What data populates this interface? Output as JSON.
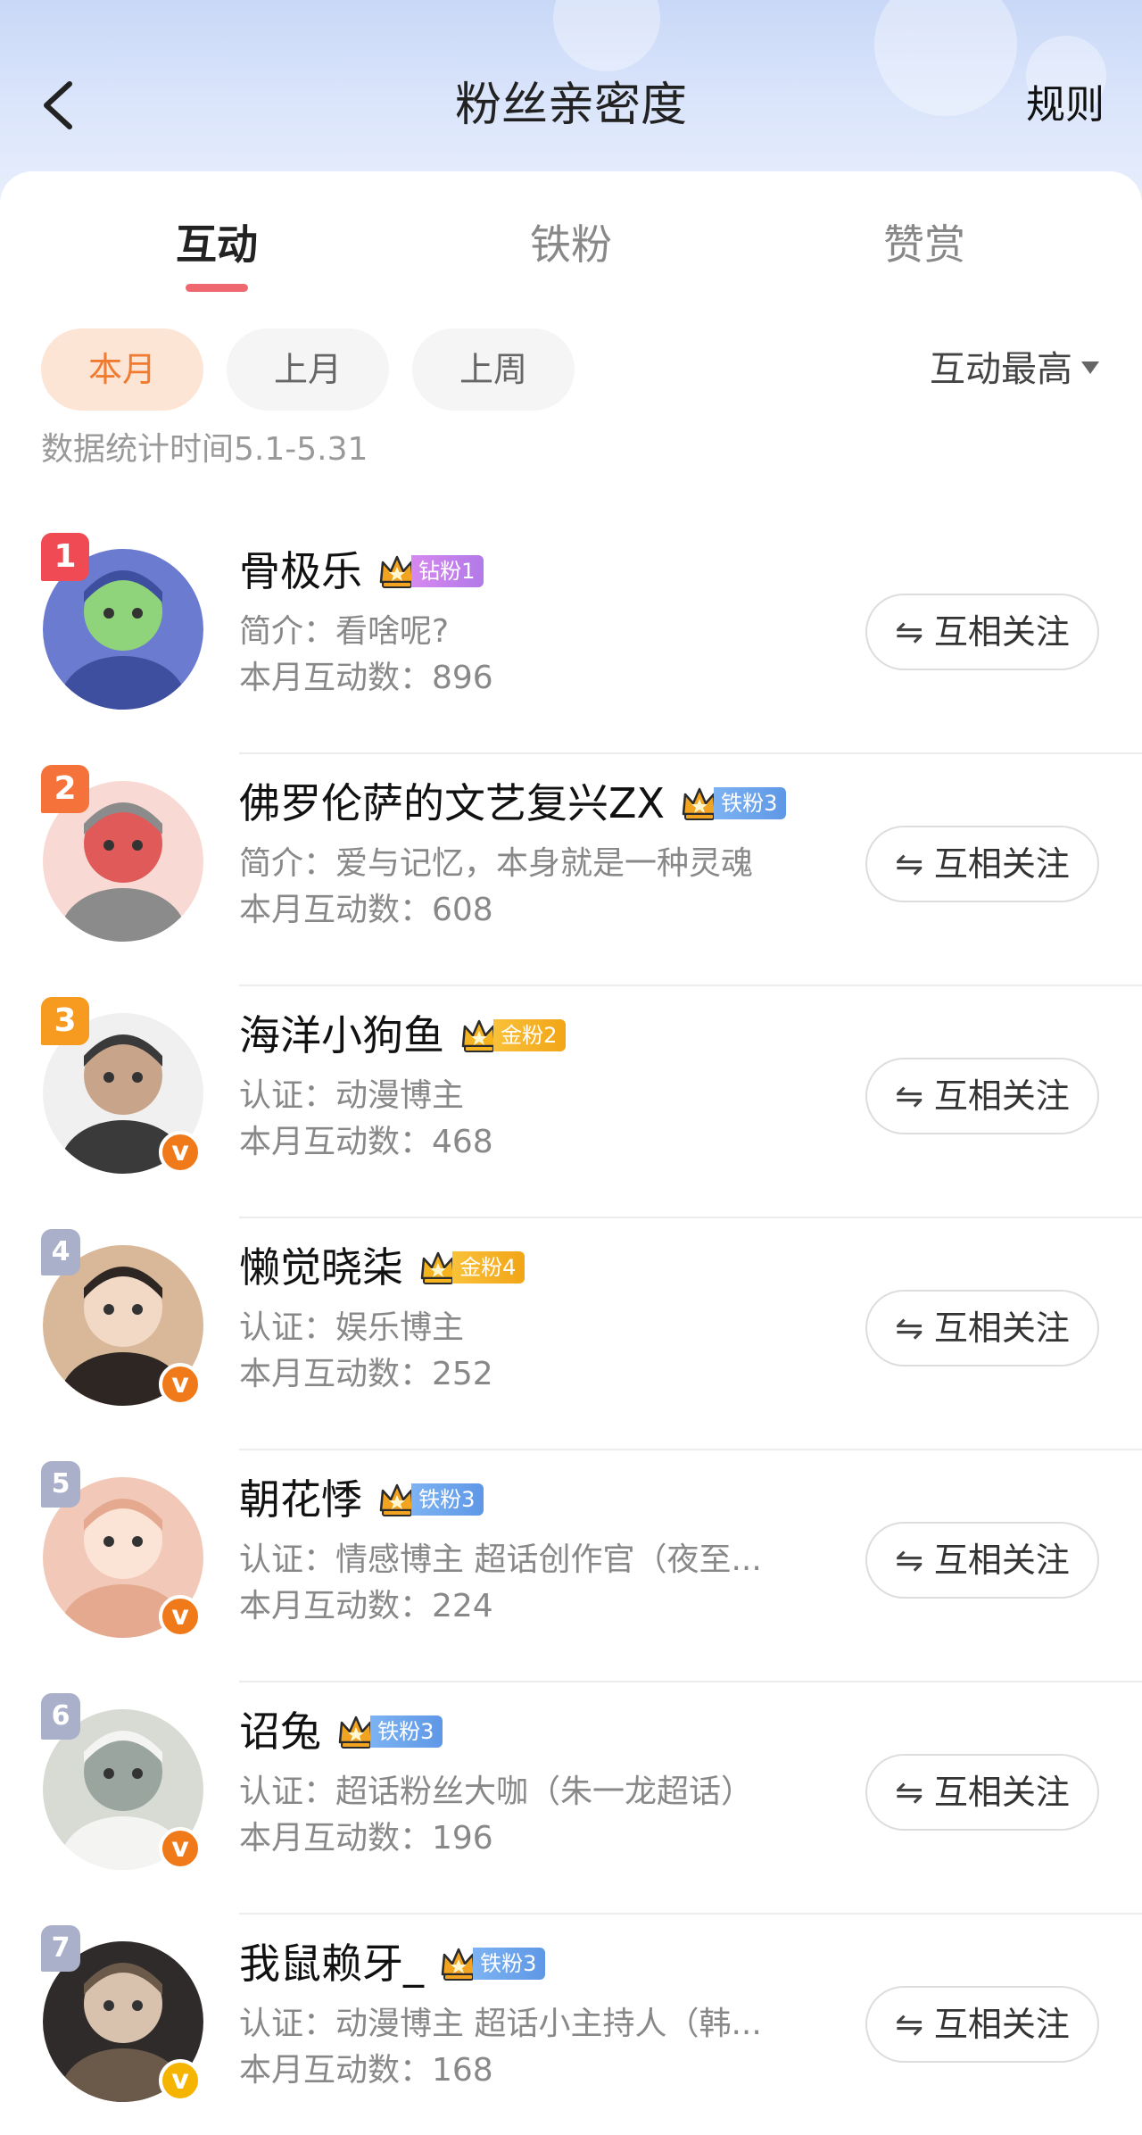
{
  "header": {
    "title": "粉丝亲密度",
    "rule_label": "规则"
  },
  "tabs": [
    {
      "label": "互动",
      "active": true
    },
    {
      "label": "铁粉",
      "active": false
    },
    {
      "label": "赞赏",
      "active": false
    }
  ],
  "filters": [
    {
      "label": "本月",
      "active": true
    },
    {
      "label": "上月",
      "active": false
    },
    {
      "label": "上周",
      "active": false
    }
  ],
  "sort_label": "互动最高",
  "stat_period": "数据统计时间5.1-5.31",
  "colors": {
    "accent": "#f0686f",
    "chip_active_bg": "#fde5d5",
    "chip_active_text": "#f07a30",
    "verified": "#f07a1a",
    "verified_gold": "#f4b400"
  },
  "icons": {
    "back": "chevron-left-icon",
    "sort": "caret-down-icon",
    "mutual_follow": "swap-arrows-icon",
    "verified": "verified-v-icon",
    "crown": "crown-icon"
  },
  "fans": [
    {
      "rank": "1",
      "name": "骨极乐",
      "badge_type": "diamond",
      "badge_label": "钻粉1",
      "desc": "简介：看啥呢?",
      "count": "本月互动数：896",
      "verified": false,
      "follow_label": "互相关注"
    },
    {
      "rank": "2",
      "name": "佛罗伦萨的文艺复兴ZX",
      "badge_type": "iron",
      "badge_label": "铁粉3",
      "desc": "简介：爱与记忆，本身就是一种灵魂",
      "count": "本月互动数：608",
      "verified": false,
      "follow_label": "互相关注"
    },
    {
      "rank": "3",
      "name": "海洋小狗鱼",
      "badge_type": "gold",
      "badge_label": "金粉2",
      "desc": "认证：动漫博主",
      "count": "本月互动数：468",
      "verified": true,
      "follow_label": "互相关注"
    },
    {
      "rank": "4",
      "name": "懒觉晓柒",
      "badge_type": "gold",
      "badge_label": "金粉4",
      "desc": "认证：娱乐博主",
      "count": "本月互动数：252",
      "verified": true,
      "follow_label": "互相关注"
    },
    {
      "rank": "5",
      "name": "朝花悸",
      "badge_type": "iron",
      "badge_label": "铁粉3",
      "desc": "认证：情感博主 超话创作官（夜至...",
      "count": "本月互动数：224",
      "verified": true,
      "follow_label": "互相关注"
    },
    {
      "rank": "6",
      "name": "诏兔",
      "badge_type": "iron",
      "badge_label": "铁粉3",
      "desc": "认证：超话粉丝大咖（朱一龙超话）",
      "count": "本月互动数：196",
      "verified": true,
      "follow_label": "互相关注"
    },
    {
      "rank": "7",
      "name": "我鼠赖牙_",
      "badge_type": "iron",
      "badge_label": "铁粉3",
      "desc": "认证：动漫博主 超话小主持人（韩...",
      "count": "本月互动数：168",
      "verified": true,
      "verified_gold": true,
      "follow_label": "互相关注"
    }
  ]
}
